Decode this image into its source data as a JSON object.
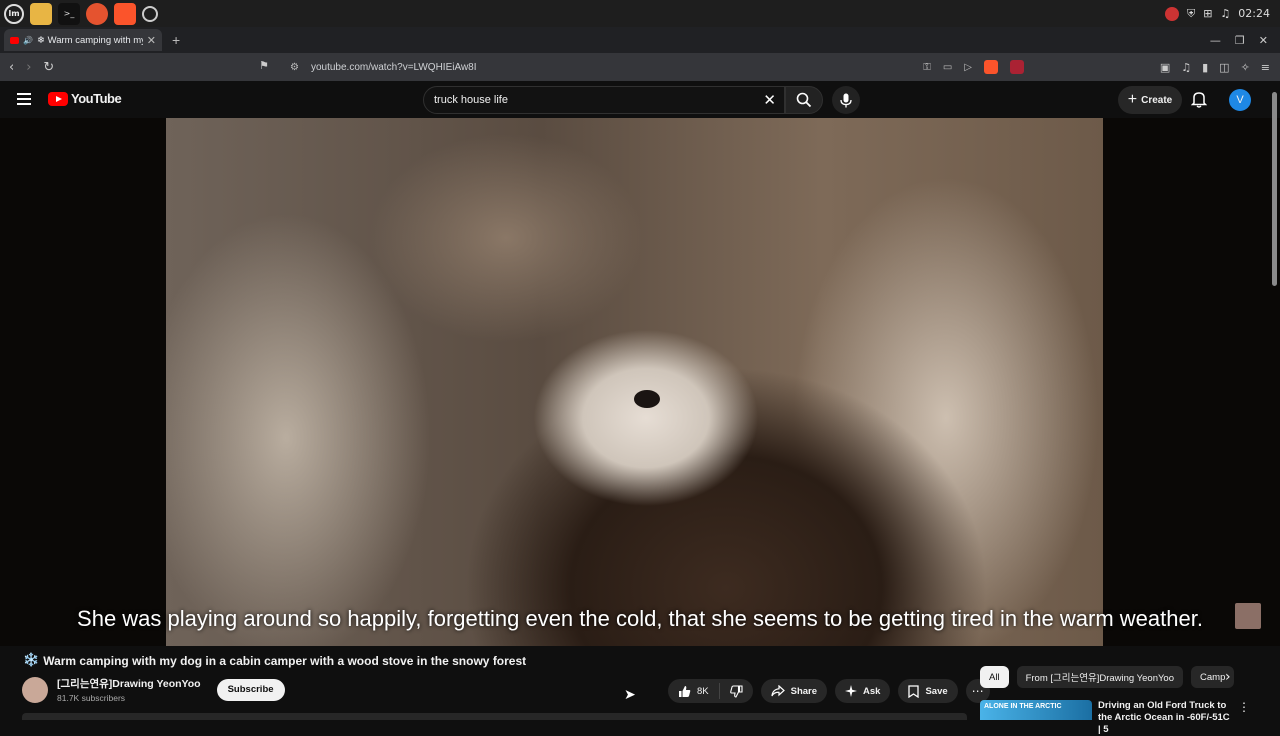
{
  "os": {
    "clock": "02:24",
    "terminal_glyph": ">_"
  },
  "browser": {
    "tab_title": "Warm camping with my",
    "tab_speaker": "🔊",
    "tab_snow": "❄",
    "tab_close": "✕",
    "new_tab": "+",
    "url": "youtube.com/watch?v=LWQHIEiAw8I"
  },
  "youtube": {
    "logo_text": "YouTube",
    "search_value": "truck house life",
    "search_clear": "✕",
    "create_label": "Create",
    "create_plus": "+",
    "avatar_letter": "V"
  },
  "video": {
    "subtitle": "She was playing around so happily, forgetting even the cold, that she seems to be getting tired in the warm weather."
  },
  "info": {
    "title_emoji": "❄️",
    "title": "Warm camping with my dog in a cabin camper with a wood stove in the snowy forest",
    "channel_name": "[그리는연유]Drawing YeonYoo",
    "channel_subs": "81.7K subscribers",
    "subscribe_label": "Subscribe",
    "like_count": "8K",
    "share_label": "Share",
    "ask_label": "Ask",
    "save_label": "Save",
    "more_label": "⋯"
  },
  "chips": [
    {
      "label": "All"
    },
    {
      "label": "From [그리는연유]Drawing YeonYoo"
    },
    {
      "label": "Camp"
    }
  ],
  "recommendation": {
    "thumb_text": "ALONE IN THE ARCTIC",
    "title": "Driving an Old Ford Truck to the Arctic Ocean in -60F/-51C | 5"
  }
}
